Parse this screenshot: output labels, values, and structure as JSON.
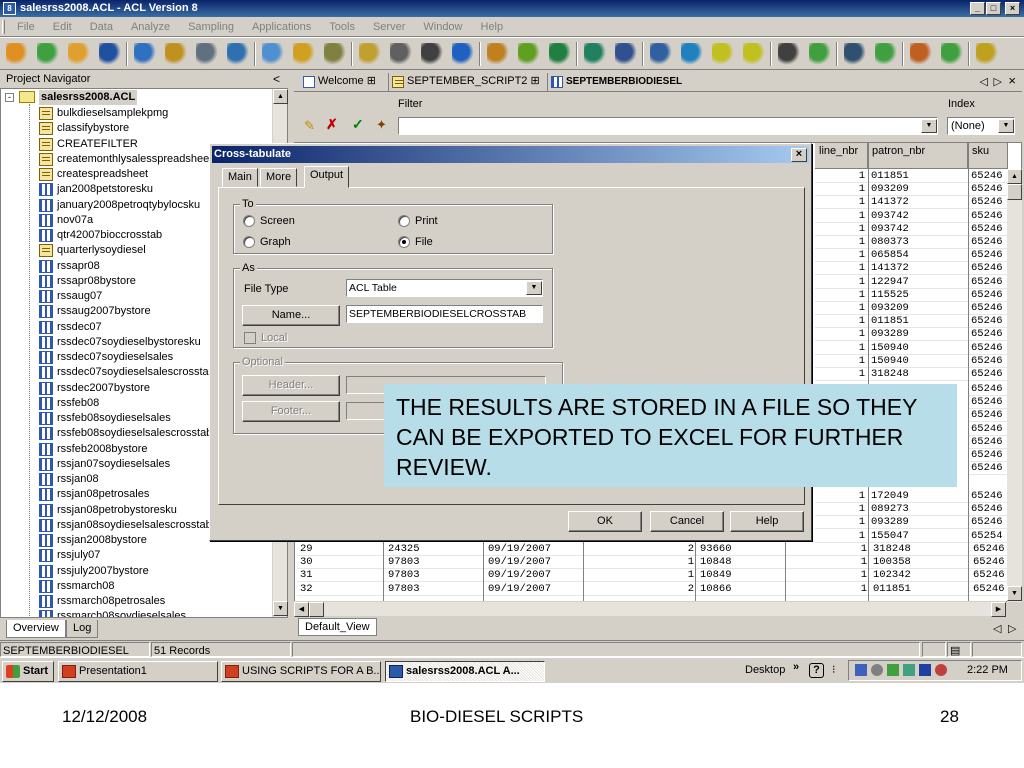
{
  "window": {
    "title": "salesrss2008.ACL - ACL Version 8",
    "app_icon": "8",
    "min": "_",
    "max": "□",
    "close": "×"
  },
  "menu": [
    "File",
    "Edit",
    "Data",
    "Analyze",
    "Sampling",
    "Applications",
    "Tools",
    "Server",
    "Window",
    "Help"
  ],
  "toolbar_icons": [
    "open-project-icon",
    "open-script-icon",
    "close-icon",
    "save-icon",
    "print-icon",
    "find-icon",
    "restore-icon",
    "table-layout-icon",
    "extract-icon",
    "copy-icon",
    "edit-icon",
    "add-column-icon",
    "filter-icon",
    "index-icon",
    "search-icon",
    "statistics-icon",
    "profile-icon",
    "verify-icon",
    "percent-icon",
    "classify-icon",
    "stratify-icon",
    "summarize-icon",
    "age-icon",
    "count-icon",
    "total-icon",
    "histogram-icon",
    "report-icon",
    "refresh-icon",
    "script-run-icon",
    "layout-grid-icon",
    "help-icon"
  ],
  "navigator": {
    "header": "Project Navigator",
    "collapse": "<",
    "root": "salesrss2008.ACL",
    "expand": "-",
    "items": [
      {
        "label": "bulkdieselsamplekpmg",
        "type": "script"
      },
      {
        "label": "classifybystore",
        "type": "script"
      },
      {
        "label": "CREATEFILTER",
        "type": "script"
      },
      {
        "label": "createmonthlysalesspreadsheet",
        "type": "script"
      },
      {
        "label": "createspreadsheet",
        "type": "script"
      },
      {
        "label": "jan2008petstoresku",
        "type": "table"
      },
      {
        "label": "january2008petroqtybylocsku",
        "type": "table"
      },
      {
        "label": "nov07a",
        "type": "table"
      },
      {
        "label": "qtr42007bioccrosstab",
        "type": "table"
      },
      {
        "label": "quarterlysoydiesel",
        "type": "script"
      },
      {
        "label": "rssapr08",
        "type": "table"
      },
      {
        "label": "rssapr08bystore",
        "type": "table"
      },
      {
        "label": "rssaug07",
        "type": "table"
      },
      {
        "label": "rssaug2007bystore",
        "type": "table"
      },
      {
        "label": "rssdec07",
        "type": "table"
      },
      {
        "label": "rssdec07soydieselbystoresku",
        "type": "table"
      },
      {
        "label": "rssdec07soydieselsales",
        "type": "table"
      },
      {
        "label": "rssdec07soydieselsalescrosstab",
        "type": "table"
      },
      {
        "label": "rssdec2007bystore",
        "type": "table"
      },
      {
        "label": "rssfeb08",
        "type": "table"
      },
      {
        "label": "rssfeb08soydieselsales",
        "type": "table"
      },
      {
        "label": "rssfeb08soydieselsalescrosstab",
        "type": "table"
      },
      {
        "label": "rssfeb2008bystore",
        "type": "table"
      },
      {
        "label": "rssjan07soydieselsales",
        "type": "table"
      },
      {
        "label": "rssjan08",
        "type": "table"
      },
      {
        "label": "rssjan08petrosales",
        "type": "table"
      },
      {
        "label": "rssjan08petrobystoresku",
        "type": "table"
      },
      {
        "label": "rssjan08soydieselsalescrosstab",
        "type": "table"
      },
      {
        "label": "rssjan2008bystore",
        "type": "table"
      },
      {
        "label": "rssjuly07",
        "type": "table"
      },
      {
        "label": "rssjuly2007bystore",
        "type": "table"
      },
      {
        "label": "rssmarch08",
        "type": "table"
      },
      {
        "label": "rssmarch08petrosales",
        "type": "table"
      },
      {
        "label": "rssmarch08soydieselsales",
        "type": "table"
      }
    ],
    "tabs": [
      "Overview",
      "Log"
    ]
  },
  "doc_tabs": [
    {
      "label": "Welcome",
      "icon": "page-icon"
    },
    {
      "label": "SEPTEMBER_SCRIPT2",
      "icon": "script-icon"
    },
    {
      "label": "SEPTEMBERBIODIESEL",
      "icon": "table-icon"
    }
  ],
  "filter": {
    "label": "Filter",
    "value": ""
  },
  "index": {
    "label": "Index",
    "value": "(None)"
  },
  "grid": {
    "headers": [
      "line_nbr",
      "patron_nbr",
      "sku"
    ],
    "rows_top": [
      [
        "1",
        "011851",
        "65246"
      ],
      [
        "1",
        "093209",
        "65246"
      ],
      [
        "1",
        "141372",
        "65246"
      ],
      [
        "1",
        "093742",
        "65246"
      ],
      [
        "1",
        "093742",
        "65246"
      ],
      [
        "1",
        "080373",
        "65246"
      ],
      [
        "1",
        "065854",
        "65246"
      ],
      [
        "1",
        "141372",
        "65246"
      ],
      [
        "1",
        "122947",
        "65246"
      ],
      [
        "1",
        "115525",
        "65246"
      ],
      [
        "1",
        "093209",
        "65246"
      ],
      [
        "1",
        "011851",
        "65246"
      ],
      [
        "1",
        "093289",
        "65246"
      ],
      [
        "1",
        "150940",
        "65246"
      ],
      [
        "1",
        "150940",
        "65246"
      ],
      [
        "1",
        "318248",
        "65246"
      ]
    ],
    "sku_partial": [
      "65246",
      "65246",
      "65246",
      "65246",
      "65246",
      "65246",
      "65246"
    ],
    "rows_mid": [
      [
        "1",
        "172049",
        "65246"
      ],
      [
        "1",
        "089273",
        "65246"
      ],
      [
        "1",
        "093289",
        "65246"
      ],
      [
        "1",
        "155047",
        "65254"
      ]
    ],
    "rows_bottom": [
      [
        "29",
        "24325",
        "09/19/2007",
        "2",
        "93660",
        "1",
        "318248",
        "65246"
      ],
      [
        "30",
        "97803",
        "09/19/2007",
        "1",
        "10848",
        "1",
        "100358",
        "65246"
      ],
      [
        "31",
        "97803",
        "09/19/2007",
        "1",
        "10849",
        "1",
        "102342",
        "65246"
      ],
      [
        "32",
        "97803",
        "09/19/2007",
        "2",
        "10866",
        "1",
        "011851",
        "65246"
      ]
    ],
    "view_tab": "Default_View"
  },
  "status": {
    "table": "SEPTEMBERBIODIESEL",
    "records": "51 Records"
  },
  "taskbar": {
    "start": "Start",
    "buttons": [
      "Presentation1",
      "USING SCRIPTS FOR A B...",
      "salesrss2008.ACL  A..."
    ],
    "desktop": "Desktop",
    "chevron": "»",
    "time": "2:22 PM"
  },
  "dialog": {
    "title": "Cross-tabulate",
    "close": "×",
    "tabs": [
      "Main",
      "More",
      "Output"
    ],
    "to_group": "To",
    "to_options": [
      {
        "label": "Screen",
        "checked": false
      },
      {
        "label": "Print",
        "checked": false
      },
      {
        "label": "Graph",
        "checked": false
      },
      {
        "label": "File",
        "checked": true
      }
    ],
    "as_group": "As",
    "file_type_label": "File Type",
    "file_type_value": "ACL Table",
    "name_button": "Name...",
    "name_value": "SEPTEMBERBIODIESELCROSSTAB",
    "local_label": "Local",
    "optional_group": "Optional",
    "header_button": "Header...",
    "footer_button": "Footer...",
    "ok": "OK",
    "cancel": "Cancel",
    "help": "Help"
  },
  "callout": "THE RESULTS ARE STORED IN A FILE SO THEY CAN BE EXPORTED TO EXCEL FOR FURTHER REVIEW.",
  "slide": {
    "date": "12/12/2008",
    "title": "BIO-DIESEL SCRIPTS",
    "page": "28"
  }
}
